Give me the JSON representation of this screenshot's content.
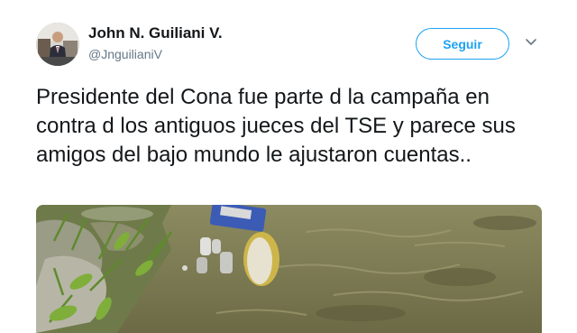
{
  "tweet": {
    "author": {
      "display_name": "John N. Guiliani V.",
      "handle": "@JnguilianiV",
      "avatar_icon": "profile-photo"
    },
    "follow_button_label": "Seguir",
    "caret_icon": "chevron-down-icon",
    "text": "Presidente del Cona fue parte d la campaña en contra d los antiguos jueces del TSE y parece sus amigos del bajo mundo le ajustaron cuentas..",
    "media": {
      "description_icon": "attached-photo"
    }
  },
  "colors": {
    "accent": "#1da1f2",
    "text_primary": "#14171a",
    "text_secondary": "#657786"
  }
}
